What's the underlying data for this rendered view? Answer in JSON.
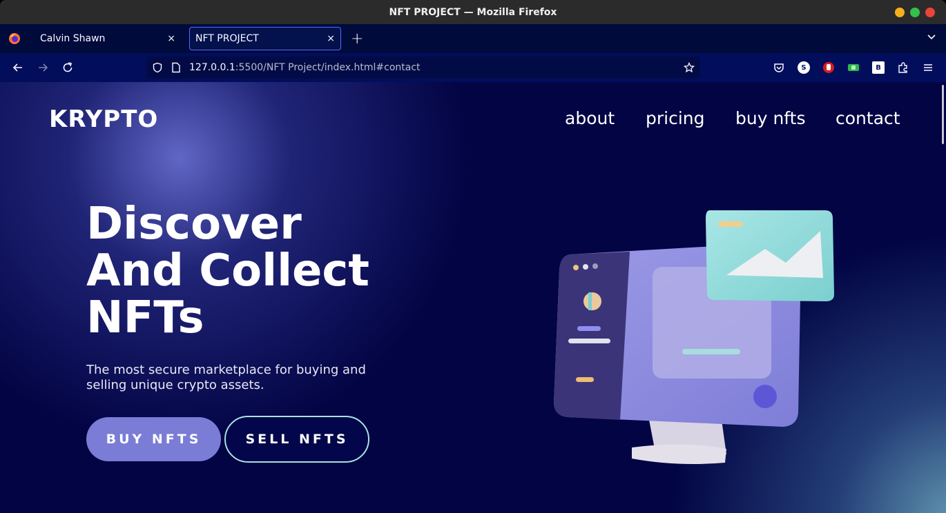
{
  "window": {
    "title": "NFT PROJECT — Mozilla Firefox"
  },
  "tabs": [
    {
      "label": "Calvin Shawn",
      "close": "×"
    },
    {
      "label": "NFT PROJECT",
      "close": "×"
    }
  ],
  "new_tab": "+",
  "url": {
    "host": "127.0.0.1",
    "rest": ":5500/NFT Project/index.html#contact"
  },
  "extensions": [
    "S",
    "B"
  ],
  "site": {
    "logo": "KRYPTO",
    "menu": [
      "about",
      "pricing",
      "buy nfts",
      "contact"
    ],
    "hero": {
      "title_lines": [
        "Discover",
        "And Collect",
        "NFTs"
      ],
      "subtitle": "The most secure marketplace for buying and selling unique crypto assets.",
      "buy_label": "BUY NFTS",
      "sell_label": "SELL NFTS"
    }
  },
  "colors": {
    "page_bg": "#020444",
    "accent": "#7a7cd6",
    "sell_border": "#a9e3e3"
  }
}
